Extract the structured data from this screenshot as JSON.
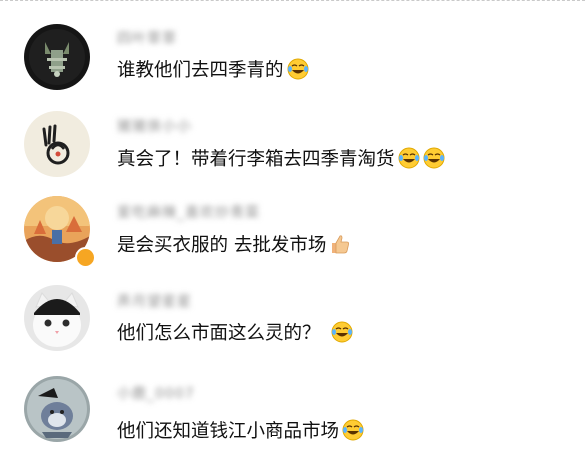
{
  "comments": [
    {
      "username": "四叶草草",
      "text": "谁教他们去四季青的",
      "emojis": [
        "laugh-cry-emoji"
      ]
    },
    {
      "username": "猪猪侠小小",
      "text": "真会了！带着行李箱去四季青淘货",
      "emojis": [
        "laugh-cry-emoji",
        "laugh-cry-emoji"
      ]
    },
    {
      "username": "爱吃麻辣_喜欢炒青菜",
      "text": "是会买衣服的 去批发市场",
      "emojis": [
        "thumbs-up-emoji"
      ]
    },
    {
      "username": "弄月望星星",
      "text": "他们怎么市面这么灵的？",
      "emojis": [
        "laugh-cry-emoji"
      ]
    },
    {
      "username": "小鹿_0007",
      "text": "他们还知道钱江小商品市场",
      "emojis": [
        "laugh-cry-emoji"
      ]
    }
  ],
  "colors": {
    "username": "#8d8d8d",
    "text": "#111111",
    "verified_badge": "#f6a623",
    "emoji_face": "#ffcc33"
  }
}
